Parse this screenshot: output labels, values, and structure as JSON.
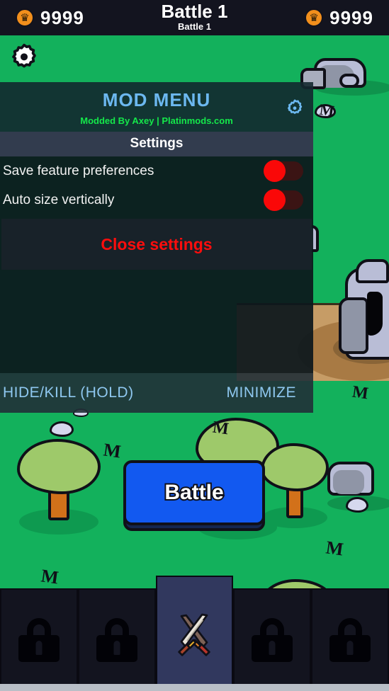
{
  "game": {
    "top_bar": {
      "left_currency": {
        "icon": "crown-coin-icon",
        "value": "9999"
      },
      "right_currency": {
        "icon": "crown-coin-icon",
        "value": "9999"
      },
      "title": "Battle 1",
      "subtitle": "Battle 1"
    },
    "settings_gear": {
      "icon": "gear-icon"
    },
    "battle_button": {
      "label": "Battle"
    },
    "bottom_nav": [
      {
        "icon": "lock-icon",
        "locked": true,
        "active": false
      },
      {
        "icon": "lock-icon",
        "locked": true,
        "active": false
      },
      {
        "icon": "crossed-swords-icon",
        "locked": false,
        "active": true
      },
      {
        "icon": "lock-icon",
        "locked": true,
        "active": false
      },
      {
        "icon": "lock-icon",
        "locked": true,
        "active": false
      }
    ],
    "colors": {
      "grass": "#13b15c",
      "dirt": "#c69c66",
      "header_bar": "#13141f",
      "coin": "#f28f1c",
      "battle_blue": "#1259f0",
      "active_tab": "#31385e"
    }
  },
  "mod_menu": {
    "title": "MOD MENU",
    "credit": "Modded By Axey | Platinmods.com",
    "gear_icon": "gear-icon",
    "section_header": "Settings",
    "settings": [
      {
        "label": "Save feature preferences",
        "toggle": "off"
      },
      {
        "label": "Auto size vertically",
        "toggle": "off"
      }
    ],
    "close_button": "Close settings",
    "footer": {
      "hide_kill": "HIDE/KILL (HOLD)",
      "minimize": "MINIMIZE"
    },
    "colors": {
      "title": "#6cb8f0",
      "credit": "#14e84a",
      "section_bg": "#323c4e",
      "toggle_off": "#fa0808",
      "close_text": "#fc0d0d",
      "footer_text": "#8fc8f0"
    }
  }
}
